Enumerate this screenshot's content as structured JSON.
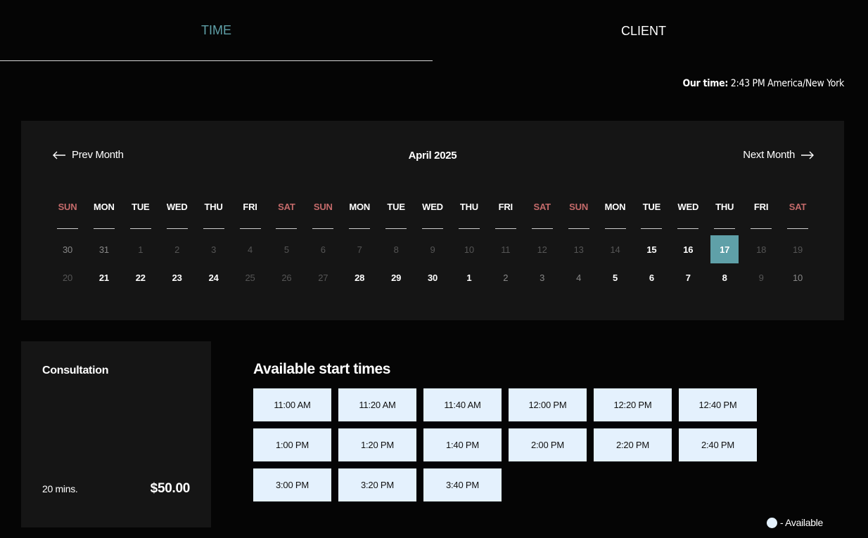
{
  "tabs": [
    {
      "label": "TIME",
      "active": true
    },
    {
      "label": "CLIENT",
      "active": false
    }
  ],
  "our_time": {
    "label": "Our time:",
    "value": "2:43 PM America/New York"
  },
  "calendar": {
    "prev_label": "Prev Month",
    "next_label": "Next Month",
    "month_title": "April 2025",
    "weekdays": [
      "SUN",
      "MON",
      "TUE",
      "WED",
      "THU",
      "FRI",
      "SAT",
      "SUN",
      "MON",
      "TUE",
      "WED",
      "THU",
      "FRI",
      "SAT",
      "SUN",
      "MON",
      "TUE",
      "WED",
      "THU",
      "FRI",
      "SAT"
    ],
    "weekend_color": "#c46a6a",
    "rows": [
      [
        {
          "d": "30",
          "s": "dim-light"
        },
        {
          "d": "31",
          "s": "dim-light"
        },
        {
          "d": "1",
          "s": "dim"
        },
        {
          "d": "2",
          "s": "dim"
        },
        {
          "d": "3",
          "s": "dim"
        },
        {
          "d": "4",
          "s": "dim"
        },
        {
          "d": "5",
          "s": "dim"
        },
        {
          "d": "6",
          "s": "dim"
        },
        {
          "d": "7",
          "s": "dim"
        },
        {
          "d": "8",
          "s": "dim"
        },
        {
          "d": "9",
          "s": "dim"
        },
        {
          "d": "10",
          "s": "dim"
        },
        {
          "d": "11",
          "s": "dim"
        },
        {
          "d": "12",
          "s": "dim"
        },
        {
          "d": "13",
          "s": "dim"
        },
        {
          "d": "14",
          "s": "dim"
        },
        {
          "d": "15",
          "s": "avail"
        },
        {
          "d": "16",
          "s": "avail"
        },
        {
          "d": "17",
          "s": "selected"
        },
        {
          "d": "18",
          "s": "dim"
        },
        {
          "d": "19",
          "s": "dim"
        }
      ],
      [
        {
          "d": "20",
          "s": "dim"
        },
        {
          "d": "21",
          "s": "avail"
        },
        {
          "d": "22",
          "s": "avail"
        },
        {
          "d": "23",
          "s": "avail"
        },
        {
          "d": "24",
          "s": "avail"
        },
        {
          "d": "25",
          "s": "dim"
        },
        {
          "d": "26",
          "s": "dim"
        },
        {
          "d": "27",
          "s": "dim"
        },
        {
          "d": "28",
          "s": "avail"
        },
        {
          "d": "29",
          "s": "avail"
        },
        {
          "d": "30",
          "s": "avail"
        },
        {
          "d": "1",
          "s": "avail"
        },
        {
          "d": "2",
          "s": "dim-light"
        },
        {
          "d": "3",
          "s": "dim-light"
        },
        {
          "d": "4",
          "s": "dim-light"
        },
        {
          "d": "5",
          "s": "avail"
        },
        {
          "d": "6",
          "s": "avail"
        },
        {
          "d": "7",
          "s": "avail"
        },
        {
          "d": "8",
          "s": "avail"
        },
        {
          "d": "9",
          "s": "dim"
        },
        {
          "d": "10",
          "s": "dim-light"
        }
      ]
    ]
  },
  "service": {
    "name": "Consultation",
    "duration": "20 mins.",
    "price": "$50.00"
  },
  "times": {
    "title": "Available start times",
    "slots": [
      "11:00 AM",
      "11:20 AM",
      "11:40 AM",
      "12:00 PM",
      "12:20 PM",
      "12:40 PM",
      "1:00 PM",
      "1:20 PM",
      "1:40 PM",
      "2:00 PM",
      "2:20 PM",
      "2:40 PM",
      "3:00 PM",
      "3:20 PM",
      "3:40 PM"
    ]
  },
  "legend": {
    "label": "- Available"
  },
  "colors": {
    "accent": "#5fa0a8",
    "slot_bg": "#e4f1fd",
    "panel_bg": "#151515",
    "page_bg": "#050505"
  }
}
